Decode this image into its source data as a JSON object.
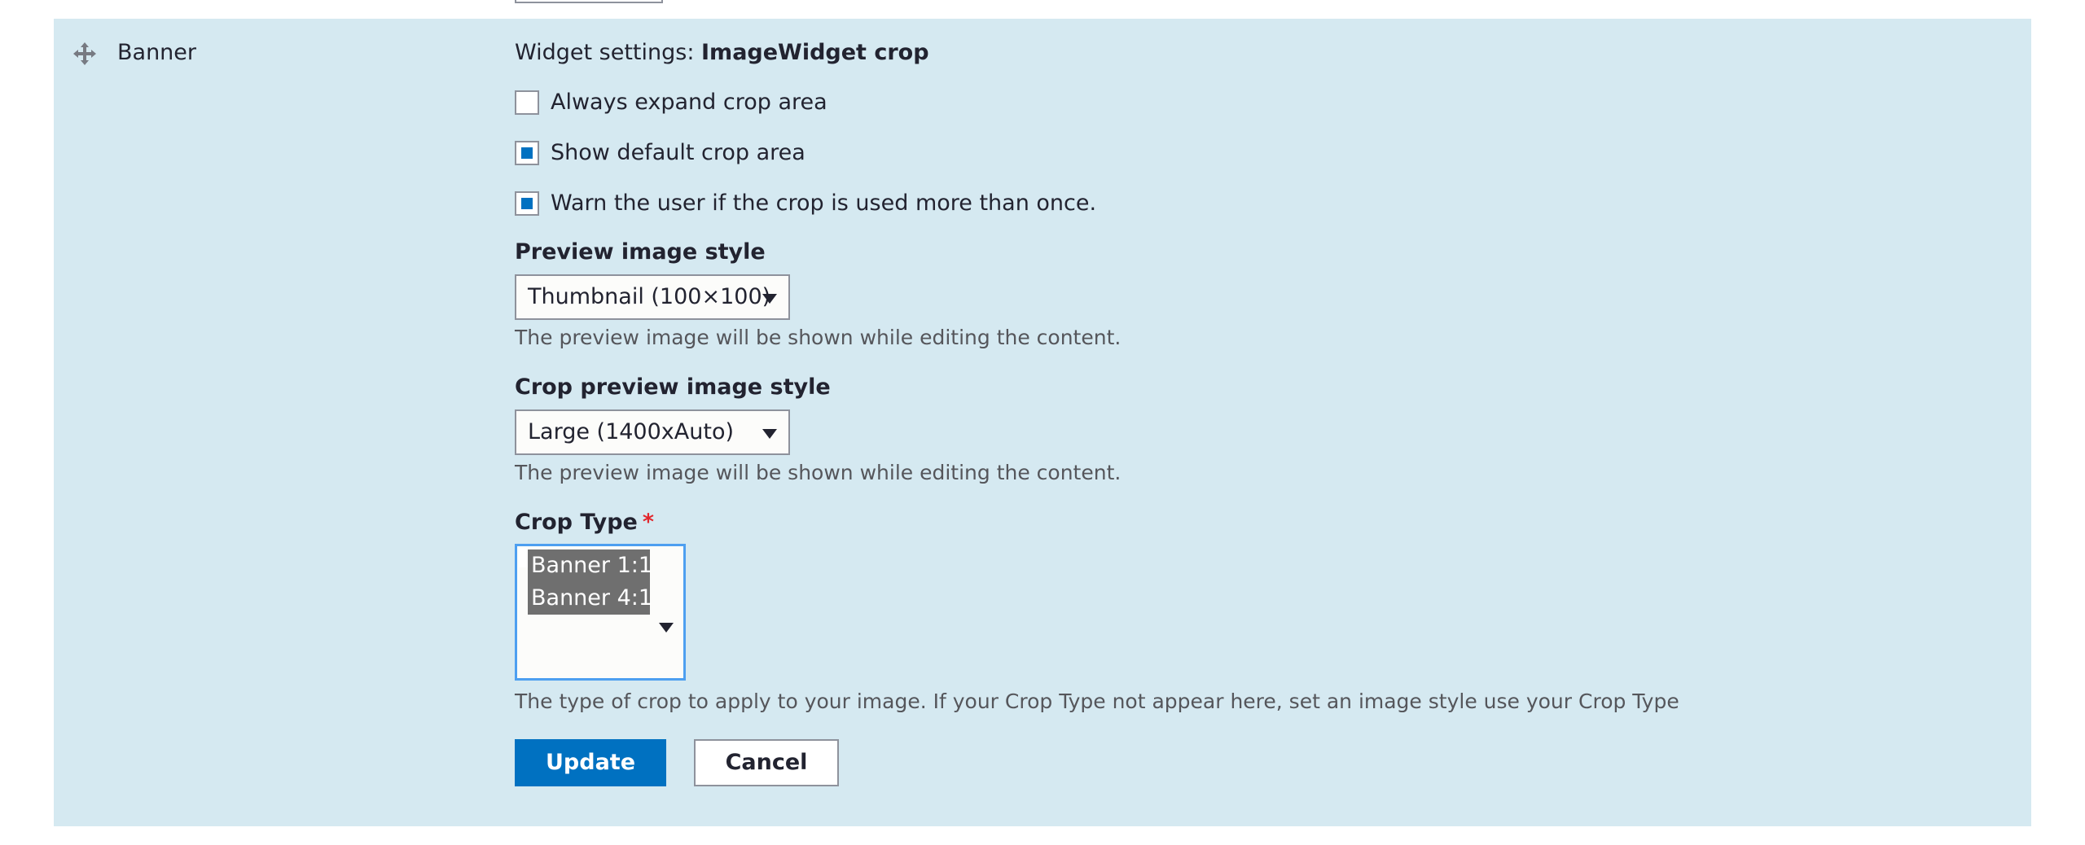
{
  "row": {
    "field_name": "Banner",
    "drag_icon": "move-arrows-icon"
  },
  "widget": {
    "settings_prefix": "Widget settings: ",
    "settings_name": "ImageWidget crop"
  },
  "checkboxes": [
    {
      "label": "Always expand crop area",
      "checked": false
    },
    {
      "label": "Show default crop area",
      "checked": true
    },
    {
      "label": "Warn the user if the crop is used more than once.",
      "checked": true
    }
  ],
  "preview_style": {
    "label": "Preview image style",
    "value": "Thumbnail (100×100)",
    "description": "The preview image will be shown while editing the content."
  },
  "crop_preview_style": {
    "label": "Crop preview image style",
    "value": "Large (1400xAuto)",
    "description": "The preview image will be shown while editing the content."
  },
  "crop_type": {
    "label": "Crop Type",
    "required_marker": "*",
    "options": [
      "Banner 1:1",
      "Banner 4:1"
    ],
    "description": "The type of crop to apply to your image. If your Crop Type not appear here, set an image style use your Crop Type"
  },
  "actions": {
    "update_label": "Update",
    "cancel_label": "Cancel"
  },
  "colors": {
    "row_background": "#d5e9f1",
    "primary": "#0071c1",
    "required": "#e2262c",
    "focus_border": "#4d9ff0"
  }
}
